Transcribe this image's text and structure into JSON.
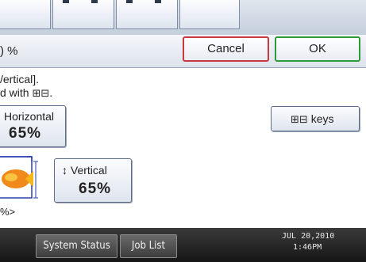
{
  "header": {
    "percent_fragment": ") %",
    "cancel_label": "Cancel",
    "ok_label": "OK"
  },
  "instructions": {
    "line1": "/ertical].",
    "line2_prefix": "d with ",
    "line2_keys": "⊞⊟",
    "line2_suffix": "."
  },
  "horizontal": {
    "label": "Horizontal",
    "value": "65%"
  },
  "keys_button": {
    "glyph": "⊞⊟",
    "label": "keys"
  },
  "vertical": {
    "arrow": "↕",
    "label": "Vertical",
    "value": "65%"
  },
  "bottom_note": "%>",
  "status_bar": {
    "system_status_label": "System Status",
    "job_list_label": "Job List",
    "date": "JUL  20,2010",
    "time": "1:46PM"
  },
  "colors": {
    "cancel_border": "#c8383f",
    "ok_border": "#2f9a3a",
    "button_border": "#5d6d86"
  },
  "icons": {
    "preview": "image-preview-icon",
    "vertical_arrow": "up-down-arrow-icon",
    "keypad": "keypad-keys-icon"
  }
}
